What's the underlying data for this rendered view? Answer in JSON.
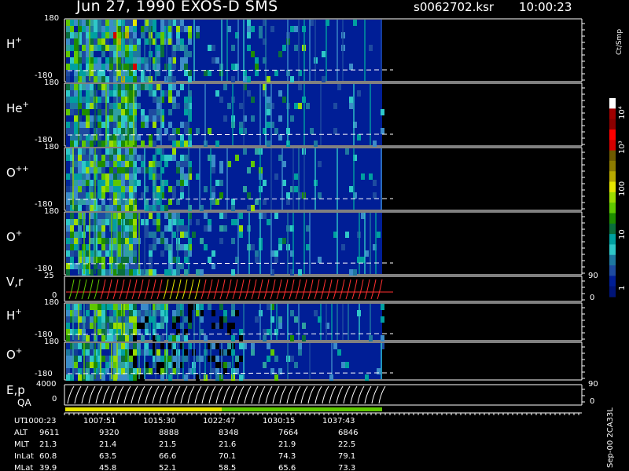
{
  "header": {
    "title": "Jun 27, 1990   EXOS-D SMS",
    "file_id": "s0062702.ksr",
    "time": "10:00:23"
  },
  "panels": [
    {
      "label": "H",
      "sup": "+",
      "top_tick": "180",
      "bottom_tick": "-180"
    },
    {
      "label": "He",
      "sup": "+",
      "top_tick": "180",
      "bottom_tick": "-180"
    },
    {
      "label": "O",
      "sup": "++",
      "top_tick": "180",
      "bottom_tick": "-180"
    },
    {
      "label": "O",
      "sup": "+",
      "top_tick": "180",
      "bottom_tick": "-180"
    },
    {
      "label": "V,r",
      "sup": "",
      "top_tick": "25",
      "bottom_tick": "0",
      "right_top": "90",
      "right_bottom": "0"
    },
    {
      "label": "H",
      "sup": "+",
      "top_tick": "180",
      "bottom_tick": "-180"
    },
    {
      "label": "O",
      "sup": "+",
      "top_tick": "180",
      "bottom_tick": "-180"
    },
    {
      "label": "E,p",
      "sup": "",
      "top_tick": "4000",
      "bottom_tick": "0",
      "right_top": "90",
      "right_bottom": "0"
    }
  ],
  "qa_label": "QA",
  "colorbar": {
    "unit": "Ct/Smp",
    "labels": [
      "10⁴",
      "10³",
      "100",
      "10",
      "1"
    ],
    "colors": [
      "#ffffff",
      "#a00000",
      "#8b0000",
      "#ff0000",
      "#d40000",
      "#6e5a00",
      "#8c7a00",
      "#b8a800",
      "#e6e600",
      "#9bdc00",
      "#5fc800",
      "#1e8c00",
      "#0a6e3c",
      "#00a0a0",
      "#2fc8c8",
      "#1e78a0",
      "#1e4ba0",
      "#001e96",
      "#001478"
    ],
    "colors_comment": ""
  },
  "side_note": "Sep-00 2CA33L",
  "time_table": {
    "row_labels": [
      "UT",
      "ALT",
      "MLT",
      "InLat",
      "MLat"
    ],
    "columns": [
      [
        "1000:23",
        "9611",
        "21.3",
        "60.8",
        "39.9"
      ],
      [
        "1007:51",
        "9320",
        "21.4",
        "63.5",
        "45.8"
      ],
      [
        "1015:30",
        "8888",
        "21.5",
        "66.6",
        "52.1"
      ],
      [
        "1022:47",
        "8348",
        "21.6",
        "70.1",
        "58.5"
      ],
      [
        "1030:15",
        "7664",
        "21.9",
        "74.3",
        "65.6"
      ],
      [
        "1037:43",
        "6846",
        "22.5",
        "79.1",
        "73.3"
      ]
    ]
  },
  "chart_data": {
    "type": "heatmap",
    "title": "Jun 27, 1990   EXOS-D SMS",
    "x": [
      "1000:23",
      "1007:51",
      "1015:30",
      "1022:47",
      "1030:15",
      "1037:43"
    ],
    "xlabel": "UT",
    "series": [
      {
        "name": "H+",
        "ylim": [
          -180,
          180
        ]
      },
      {
        "name": "He+",
        "ylim": [
          -180,
          180
        ]
      },
      {
        "name": "O++",
        "ylim": [
          -180,
          180
        ]
      },
      {
        "name": "O+",
        "ylim": [
          -180,
          180
        ]
      },
      {
        "name": "V,r",
        "ylim": [
          0,
          25
        ]
      },
      {
        "name": "H+",
        "ylim": [
          -180,
          180
        ]
      },
      {
        "name": "O+",
        "ylim": [
          -180,
          180
        ]
      },
      {
        "name": "E,p",
        "ylim": [
          0,
          4000
        ]
      }
    ],
    "colorscale": {
      "unit": "Ct/Smp",
      "range": [
        1,
        10000
      ],
      "log": true
    }
  }
}
